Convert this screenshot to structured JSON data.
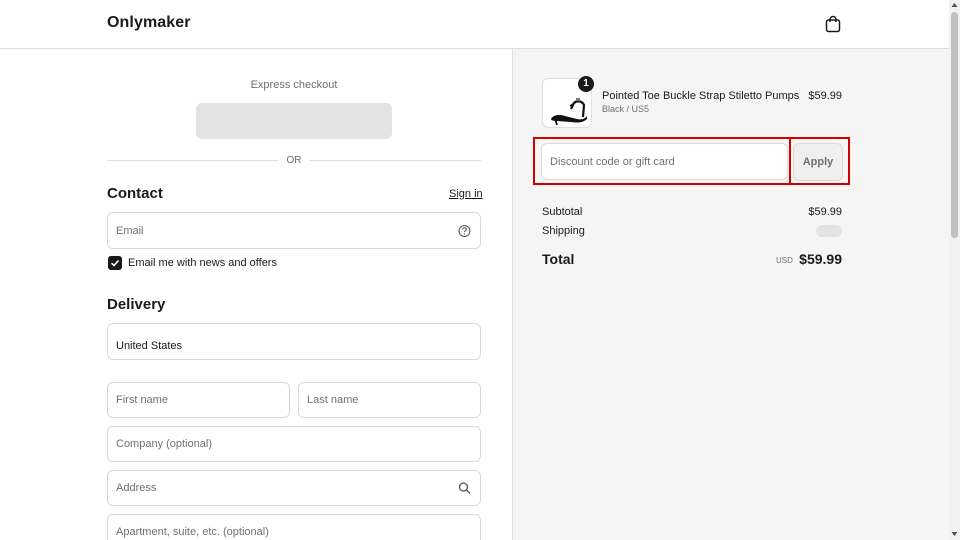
{
  "header": {
    "brand": "Onlymaker",
    "cart_icon": "shopping-bag-icon"
  },
  "express": {
    "label": "Express checkout",
    "or_text": "OR"
  },
  "contact": {
    "title": "Contact",
    "sign_in": "Sign in",
    "email_placeholder": "Email",
    "newsletter_label": "Email me with news and offers",
    "newsletter_checked": true
  },
  "delivery": {
    "title": "Delivery",
    "country": "United States",
    "first_name_placeholder": "First name",
    "last_name_placeholder": "Last name",
    "company_placeholder": "Company (optional)",
    "address_placeholder": "Address",
    "apartment_placeholder": "Apartment, suite, etc. (optional)"
  },
  "order": {
    "quantity": "1",
    "product_name": "Pointed Toe Buckle Strap Stiletto Pumps",
    "product_variant": "Black / US5",
    "product_price": "$59.99",
    "discount_placeholder": "Discount code or gift card",
    "apply_label": "Apply",
    "subtotal_label": "Subtotal",
    "subtotal_value": "$59.99",
    "shipping_label": "Shipping",
    "total_label": "Total",
    "currency": "USD",
    "total_value": "$59.99"
  },
  "colors": {
    "highlight": "#d40000",
    "summary_bg": "#f5f5f5",
    "text": "#1a1a1a"
  }
}
